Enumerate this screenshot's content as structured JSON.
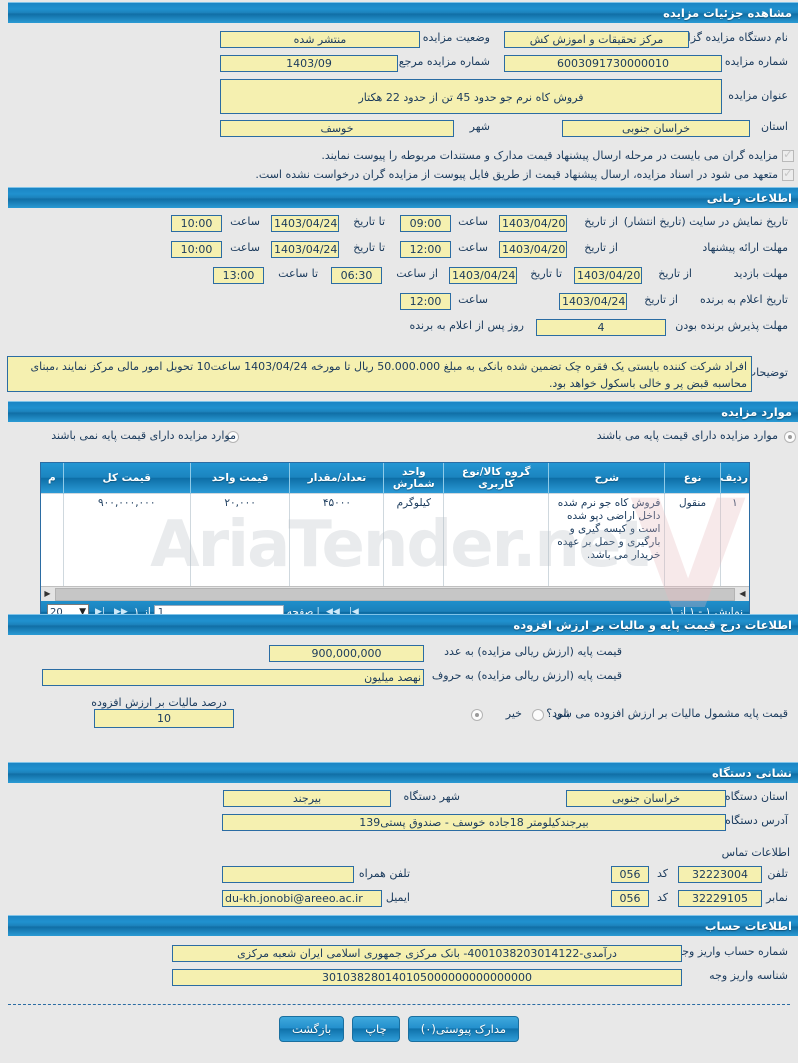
{
  "page": {
    "title": "مشاهده جزئیات مزایده"
  },
  "auction_details": {
    "org_label": "نام دستگاه مزایده گزار",
    "org_value": "مرکز تحقیقات و اموزش کش",
    "status_label": "وضعیت مزایده",
    "status_value": "منتشر شده",
    "number_label": "شماره مزایده",
    "number_value": "6003091730000010",
    "ref_number_label": "شماره مزایده مرجع",
    "ref_number_value": "1403/09",
    "subject_label": "عنوان مزایده",
    "subject_value": "فروش کاه نرم جو  حدود 45 تن از حدود 22 هکتار",
    "province_label": "استان",
    "province_value": "خراسان جنوبی",
    "city_label": "شهر",
    "city_value": "خوسف",
    "note1": "مزایده گران می بایست در مرحله ارسال پیشنهاد قیمت مدارک و مستندات مربوطه را پیوست نمایند.",
    "note2": "متعهد می شود در اسناد مزایده، ارسال پیشنهاد قیمت از طریق فایل پیوست از مزایده گران درخواست نشده است."
  },
  "time_info": {
    "header": "اطلاعات زمانی",
    "rows": [
      {
        "label": "تاریخ نمایش در سایت (تاریخ انتشار)",
        "from_label": "از تاریخ",
        "from_date": "1403/04/20",
        "time_label": "ساعت",
        "from_time": "09:00",
        "to_label": "تا تاریخ",
        "to_date": "1403/04/24",
        "time2_label": "ساعت",
        "to_time": "10:00"
      },
      {
        "label": "مهلت ارائه پیشنهاد",
        "from_label": "از تاریخ",
        "from_date": "1403/04/20",
        "time_label": "ساعت",
        "from_time": "12:00",
        "to_label": "تا تاریخ",
        "to_date": "1403/04/24",
        "time2_label": "ساعت",
        "to_time": "10:00"
      },
      {
        "label": "مهلت بازدید",
        "from_label": "از تاریخ",
        "from_date": "1403/04/20",
        "to_label": "تا تاریخ",
        "to_date": "1403/04/24",
        "time_label": "از ساعت",
        "from_time": "06:30",
        "time2_label": "تا ساعت",
        "to_time": "13:00"
      },
      {
        "label": "تاریخ اعلام به برنده",
        "from_label": "از تاریخ",
        "from_date": "1403/04/24",
        "time_label": "ساعت",
        "from_time": "12:00"
      }
    ],
    "accept_label": "مهلت پذیرش برنده بودن",
    "accept_value": "4",
    "accept_suffix": "روز پس از اعلام به برنده",
    "desc_label": "توضیحات",
    "desc_value": "افراد شرکت کننده بایستی یک فقره چک تضمین شده بانکی  به مبلغ 50.000.000 ریال تا مورخه 1403/04/24 ساعت10 تحویل امور مالی مرکز نمایند ،مبنای محاسبه قبض پر و خالی باسکول خواهد بود."
  },
  "auction_items": {
    "header": "موارد مزایده",
    "radio_with_base": "موارد مزایده دارای قیمت پایه می باشند",
    "radio_without_base": "موارد مزایده دارای قیمت پایه نمی باشند",
    "selected": "with_base",
    "columns": [
      "ردیف",
      "نوع",
      "شرح",
      "گروه کالا/نوع کاربری",
      "واحد شمارش",
      "تعداد/مقدار",
      "قیمت واحد",
      "قیمت کل",
      "م"
    ],
    "rows": [
      {
        "row_no": "۱",
        "type": "منقول",
        "description": "فروش کاه جو نرم شده داخل اراضی دپو شده است و کیسه گیری و بارگیری و حمل بر عهده خریدار می باشد.",
        "goods_group": "",
        "unit": "کیلوگرم",
        "quantity": "۴۵۰۰۰",
        "unit_price": "۲۰,۰۰۰",
        "total_price": "۹۰۰,۰۰۰,۰۰۰",
        "extra": ""
      }
    ],
    "footer": {
      "showing": "نمایش ۱ - ۱ از ۱",
      "page_label": "صفحه",
      "page_value": "1",
      "of_label": "از ۱",
      "page_size": "20"
    },
    "watermark": "AriaTender.net"
  },
  "base_price": {
    "header": "اطلاعات درج قیمت پایه و مالیات بر ارزش افزوده",
    "numeric_label": "قیمت پایه (ارزش ریالی مزایده) به عدد",
    "numeric_value": "900,000,000",
    "words_label": "قیمت پایه (ارزش ریالی مزایده) به حروف",
    "words_value": "نهصد میلیون",
    "vat_question": "قیمت پایه مشمول مالیات بر ارزش افزوده می شود؟",
    "vat_yes": "بلی",
    "vat_no": "خیر",
    "vat_selected": "no",
    "vat_percent_label": "درصد مالیات بر ارزش افزوده",
    "vat_percent_value": "10"
  },
  "org_address": {
    "header": "نشانی دستگاه",
    "province_label": "استان دستگاه",
    "province_value": "خراسان جنوبی",
    "city_label": "شهر دستگاه",
    "city_value": "بیرجند",
    "address_label": "آدرس دستگاه",
    "address_value": "بیرجندکیلومتر 18جاده خوسف - صندوق پستی139",
    "contact_header": "اطلاعات تماس",
    "phone_label": "تلفن",
    "phone_value": "32223004",
    "phone_code_label": "کد",
    "phone_code_value": "056",
    "mobile_label": "تلفن همراه",
    "mobile_value": "",
    "fax_label": "نمابر",
    "fax_value": "32229105",
    "fax_code_label": "کد",
    "fax_code_value": "056",
    "email_label": "ایمیل",
    "email_value": "du-kh.jonobi@areeo.ac.ir"
  },
  "account_info": {
    "header": "اطلاعات حساب",
    "account_label": "شماره حساب واریز وجه",
    "account_value": "درآمدی-4001038203014122- بانک مرکزی جمهوری اسلامی ایران شعبه مرکزی",
    "shenase_label": "شناسه واریز وجه",
    "shenase_value": "301038280140105000000000000000"
  },
  "buttons": {
    "attachments": "مدارک پیوستی(۰)",
    "print": "چاپ",
    "back": "بازگشت"
  }
}
